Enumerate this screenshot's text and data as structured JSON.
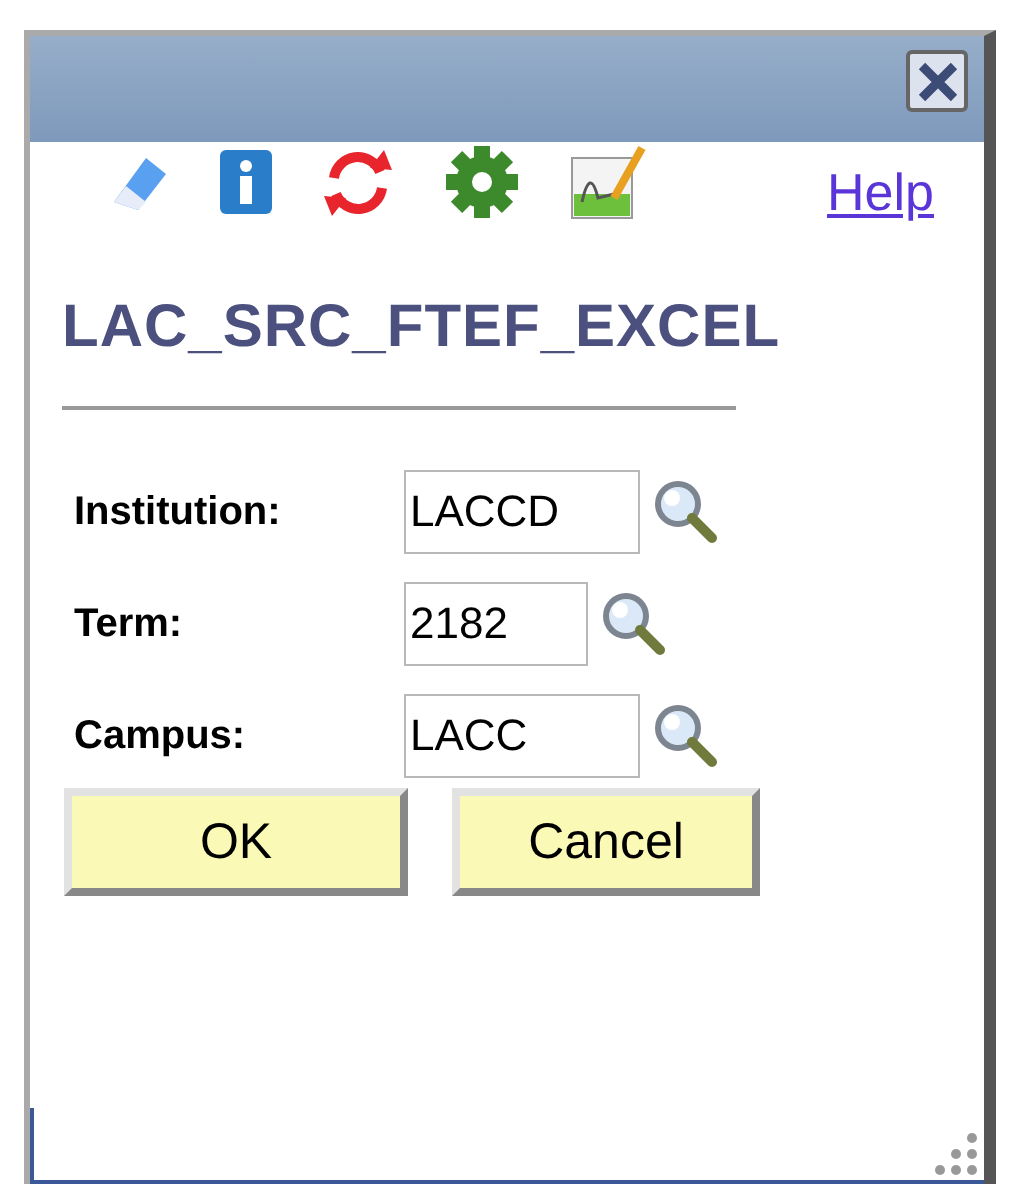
{
  "toolbar": {
    "help_link": "Help"
  },
  "title": "LAC_SRC_FTEF_EXCEL",
  "fields": [
    {
      "label": "Institution:",
      "value": "LACCD"
    },
    {
      "label": "Term:",
      "value": "2182"
    },
    {
      "label": "Campus:",
      "value": "LACC"
    }
  ],
  "buttons": [
    "OK",
    "Cancel"
  ]
}
